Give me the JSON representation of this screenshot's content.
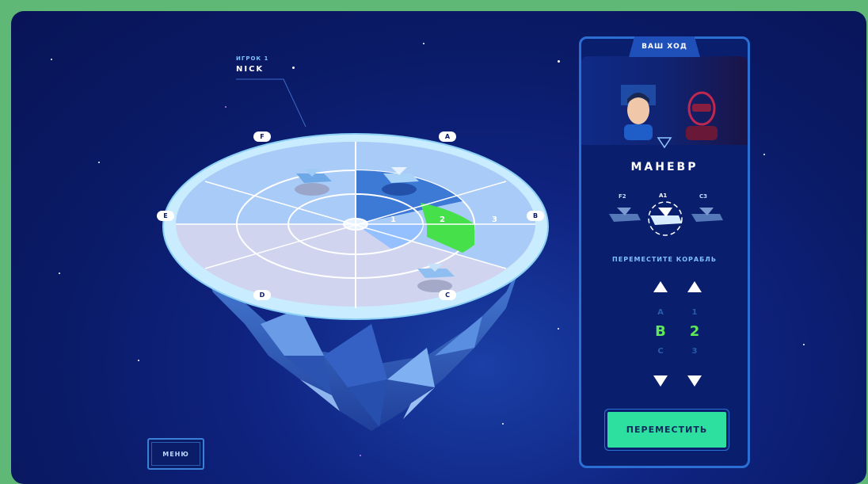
{
  "player": {
    "caption": "ИГРОК 1",
    "name": "NICK"
  },
  "menu": {
    "label": "МЕНЮ"
  },
  "board": {
    "sector_letters": [
      "A",
      "B",
      "C",
      "D",
      "E",
      "F"
    ],
    "ring_numbers": [
      "1",
      "2",
      "3"
    ],
    "selected": {
      "sector": "B",
      "ring": "2"
    },
    "colors": {
      "ring_fill": "#d0d4ee",
      "highlight": "#95c0ff",
      "selected": "#46e04a",
      "rim": "#c9ecff"
    }
  },
  "panel": {
    "header": "ВАШ ХОД",
    "mode": "МАНЕВР",
    "ships": [
      {
        "label": "F2"
      },
      {
        "label": "A1"
      },
      {
        "label": "C3"
      }
    ],
    "instruction": "ПЕРЕМЕСТИТЕ КОРАБЛЬ",
    "coords": {
      "letter": "B",
      "number": "2"
    },
    "move_button": "ПЕРЕМЕСТИТЬ"
  },
  "colors": {
    "background": "#0a1a66",
    "accent": "#2ee0a0",
    "frame": "#2c6fd4",
    "green_border": "#5fb876"
  }
}
